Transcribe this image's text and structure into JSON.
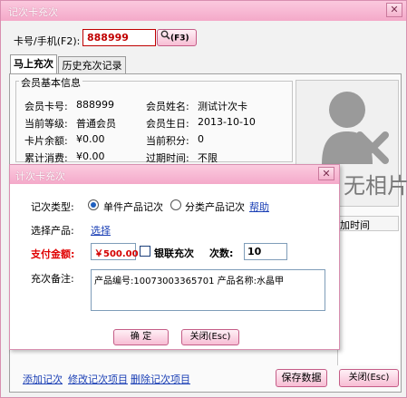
{
  "window": {
    "title": "记次卡充次",
    "close_label": "✕"
  },
  "search": {
    "label": "卡号/手机(F2):",
    "value": "888999",
    "button_label": "(F3)",
    "search_icon": "search-icon"
  },
  "tabs": [
    {
      "label": "马上充次"
    },
    {
      "label": "历史充次记录"
    }
  ],
  "member_group": {
    "title": "会员基本信息",
    "rows": [
      {
        "l1": "会员卡号:",
        "v1": "888999",
        "l2": "会员姓名:",
        "v2": "测试计次卡"
      },
      {
        "l1": "当前等级:",
        "v1": "普通会员",
        "l2": "会员生日:",
        "v2": "2013-10-10"
      },
      {
        "l1": "卡片余额:",
        "v1": "¥0.00",
        "l2": "当前积分:",
        "v2": "0"
      },
      {
        "l1": "累计消费:",
        "v1": "¥0.00",
        "l2": "过期时间:",
        "v2": "不限"
      }
    ]
  },
  "photo": {
    "placeholder": "无相片",
    "icon": "avatar-icon"
  },
  "table": {
    "col_add_time": "加时间"
  },
  "bottom": {
    "links": [
      "添加记次",
      "修改记次项目",
      "删除记次项目"
    ],
    "save_label": "保存数据",
    "close_label": "关闭(Esc)"
  },
  "dialog": {
    "title": "计次卡充次",
    "type_label": "记次类型:",
    "type_options": [
      "单件产品记次",
      "分类产品记次"
    ],
    "help_label": "帮助",
    "product_label": "选择产品:",
    "product_link": "选择",
    "pay_label": "支付金额:",
    "pay_value": "￥500.00",
    "union_pay_label": "银联充次",
    "count_label": "次数:",
    "count_value": "10",
    "note_label": "充次备注:",
    "note_value": "产品编号:10073003365701 产品名称:水晶甲",
    "ok_label": "确   定",
    "close_label": "关闭(Esc)",
    "close_x": "✕",
    "colors": {
      "required_label": "#e00000",
      "pay_value": "#d40000"
    }
  }
}
